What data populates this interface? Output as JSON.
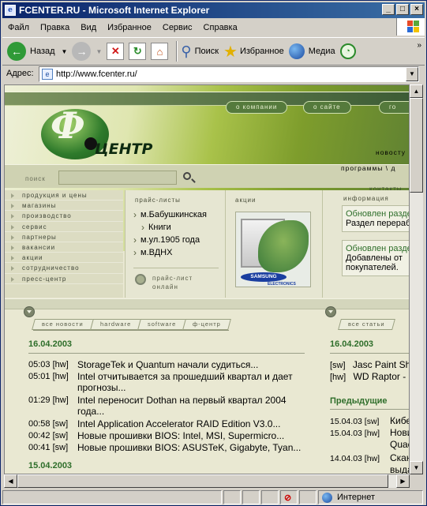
{
  "window": {
    "title": "FCENTER.RU - Microsoft Internet Explorer"
  },
  "menu": [
    "Файл",
    "Правка",
    "Вид",
    "Избранное",
    "Сервис",
    "Справка"
  ],
  "toolbar": {
    "back": "Назад",
    "search": "Поиск",
    "favorites": "Избранное",
    "media": "Медиа"
  },
  "address": {
    "label": "Адрес:",
    "url": "http://www.fcenter.ru/"
  },
  "status": {
    "zone": "Интернет"
  },
  "site": {
    "top_menu": [
      "о компании",
      "о сайте",
      "го"
    ],
    "logo_text": "ЦЕНТР",
    "header_news": "новосту",
    "header_programs": "программы \\ д",
    "search_label": "поиск",
    "contacts": "контакты",
    "left_nav": [
      "продукция и цены",
      "магазины",
      "производство",
      "сервис",
      "партнеры",
      "вакансии",
      "акции",
      "сотрудничество",
      "пресс-центр"
    ],
    "pricelists": {
      "heading": "прайс-листы",
      "items": [
        "м.Бабушкинская",
        "Книги",
        "м.ул.1905 года",
        "м.ВДНХ"
      ],
      "online": [
        "прайс-лист",
        "онлайн"
      ]
    },
    "promos": {
      "heading": "акции",
      "brand": "SAMSUNG",
      "brand_sub": "ELECTRONICS"
    },
    "info": {
      "heading": "информация",
      "items": [
        {
          "title": "Обновлен разде",
          "text": "Раздел перераб"
        },
        {
          "title": "Обновлен разде",
          "text": "Добавлены от покупателей."
        }
      ]
    },
    "news_tabs": [
      "все новости",
      "hardware",
      "software",
      "ф-центр"
    ],
    "news_date": "16.04.2003",
    "news": [
      {
        "time": "05:03 [hw]",
        "text": "StorageTek и Quantum начали судиться..."
      },
      {
        "time": "05:01 [hw]",
        "text": "Intel отчитывается за прошедший квартал и дает прогнозы..."
      },
      {
        "time": "01:29 [hw]",
        "text": "Intel переносит Dothan на первый квартал 2004 года..."
      },
      {
        "time": "00:58 [sw]",
        "text": "Intel Application Accelerator RAID Edition V3.0..."
      },
      {
        "time": "00:42 [sw]",
        "text": "Новые прошивки BIOS: Intel, MSI, Supermicro..."
      },
      {
        "time": "00:41 [sw]",
        "text": "Новые прошивки BIOS: ASUSTeK, Gigabyte, Tyan..."
      }
    ],
    "news_date2": "15.04.2003",
    "articles_tab": "все статьи",
    "articles_date": "16.04.2003",
    "articles": [
      {
        "tag": "[sw]",
        "text": "Jasc Paint Sh"
      },
      {
        "tag": "[hw]",
        "text": "WD Raptor - "
      }
    ],
    "prev_label": "Предыдущие",
    "prev": [
      {
        "tag": "15.04.03 [sw]",
        "text": "Кибе"
      },
      {
        "tag": "15.04.03 [hw]",
        "text": "Нови"
      },
      {
        "tag": "",
        "text": "Quac"
      },
      {
        "tag": "14.04.03 [hw]",
        "text": "Скан"
      },
      {
        "tag": "",
        "text": "выда"
      }
    ]
  }
}
